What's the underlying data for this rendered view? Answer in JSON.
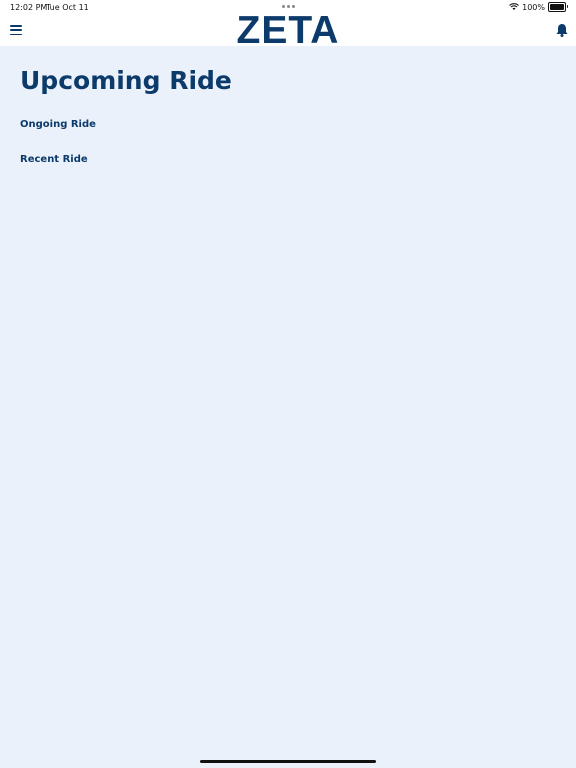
{
  "status_bar": {
    "time": "12:02 PM",
    "date": "Tue Oct 11",
    "battery": "100%"
  },
  "nav": {
    "brand": "ZETA",
    "menu_icon": "hamburger-menu-icon",
    "notification_icon": "bell-icon"
  },
  "main": {
    "title": "Upcoming Ride",
    "links": [
      "Ongoing Ride",
      "Recent Ride"
    ]
  },
  "colors": {
    "primary": "#0b3a6b",
    "background": "#eaf1fa",
    "header_bg": "#ffffff"
  }
}
